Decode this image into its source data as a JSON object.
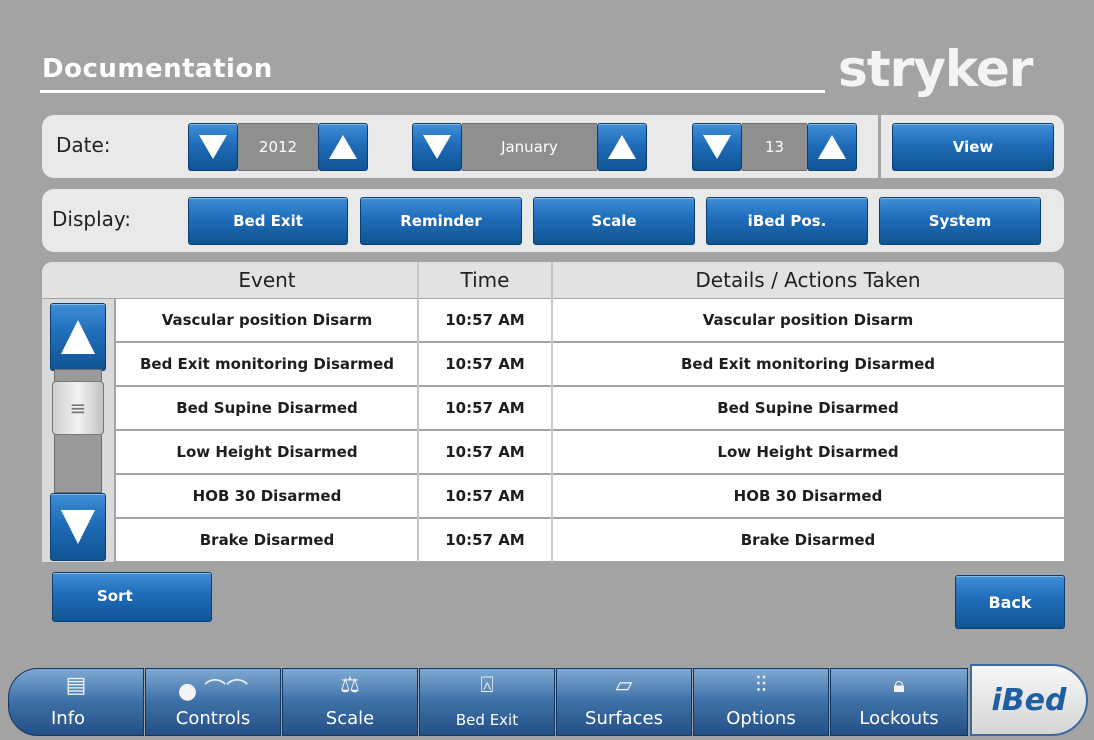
{
  "header": {
    "title": "Documentation",
    "brand": "stryker"
  },
  "date_bar": {
    "label": "Date:",
    "year": "2012",
    "month": "January",
    "day": "13",
    "view_label": "View"
  },
  "display_bar": {
    "label": "Display:",
    "filters": [
      "Bed Exit",
      "Reminder",
      "Scale",
      "iBed Pos.",
      "System"
    ]
  },
  "table": {
    "columns": [
      "Event",
      "Time",
      "Details / Actions Taken"
    ],
    "rows": [
      [
        "Vascular position Disarm",
        "10:57 AM",
        "Vascular position Disarm"
      ],
      [
        "Bed Exit monitoring Disarmed",
        "10:57 AM",
        "Bed Exit monitoring Disarmed"
      ],
      [
        "Bed Supine Disarmed",
        "10:57 AM",
        "Bed Supine Disarmed"
      ],
      [
        "Low Height Disarmed",
        "10:57 AM",
        "Low Height Disarmed"
      ],
      [
        "HOB 30 Disarmed",
        "10:57 AM",
        "HOB 30 Disarmed"
      ],
      [
        "Brake Disarmed",
        "10:57 AM",
        "Brake Disarmed"
      ]
    ]
  },
  "actions": {
    "sort_label": "Sort",
    "back_label": "Back"
  },
  "nav": {
    "tabs": [
      {
        "label": "Info",
        "icon": "document-icon"
      },
      {
        "label": "Controls",
        "icon": "patient-lying-icon"
      },
      {
        "label": "Scale",
        "icon": "balance-scale-icon"
      },
      {
        "label": "Bed Exit",
        "icon": "person-exit-icon"
      },
      {
        "label": "Surfaces",
        "icon": "mattress-icon"
      },
      {
        "label": "Options",
        "icon": "sliders-icon"
      },
      {
        "label": "Lockouts",
        "icon": "padlock-icon"
      }
    ],
    "brand": "iBed"
  },
  "colors": {
    "accent": "#1f6cb8",
    "background": "#a3a3a3",
    "panel": "#e9e9e9"
  }
}
